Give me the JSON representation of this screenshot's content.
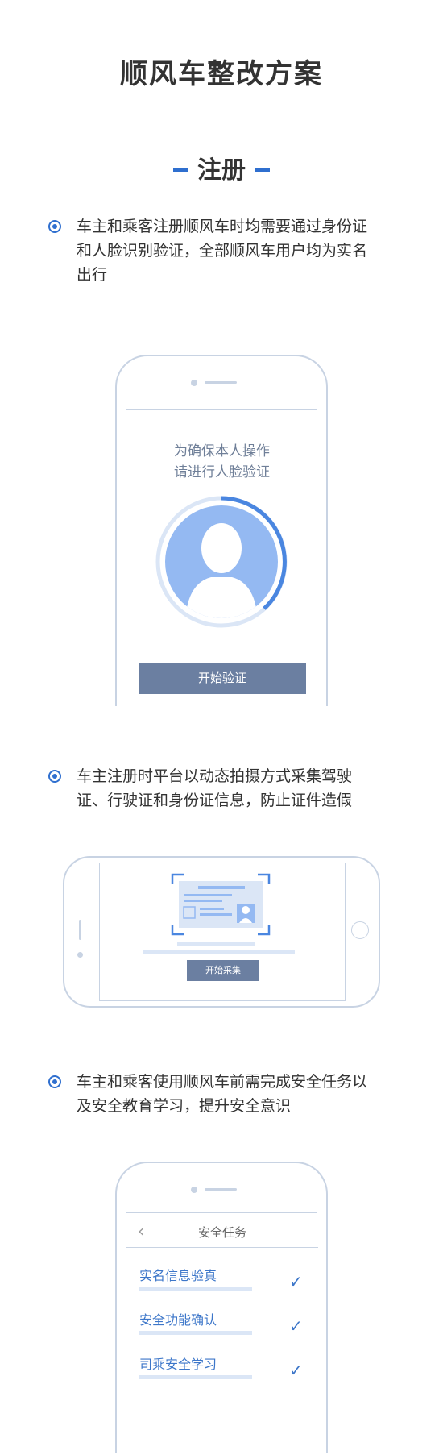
{
  "header": {
    "title": "顺风车整改方案"
  },
  "section": {
    "title": "注册"
  },
  "items": [
    {
      "text_line1": "车主和乘客注册顺风车时均需要通过身份证",
      "text_line2": "和人脸识别验证，全部顺风车用户均为实名",
      "text_line3": "出行"
    },
    {
      "text_line1": "车主注册时平台以动态拍摄方式采集驾驶",
      "text_line2": "证、行驶证和身份证信息，防止证件造假"
    },
    {
      "text_line1": "车主和乘客使用顺风车前需完成安全任务以",
      "text_line2": "及安全教育学习，提升安全意识"
    }
  ],
  "phone1": {
    "prompt_line1": "为确保本人操作",
    "prompt_line2": "请进行人脸验证",
    "button": "开始验证"
  },
  "phone2": {
    "button": "开始采集"
  },
  "phone3": {
    "nav_title": "安全任务",
    "tasks": [
      {
        "label": "实名信息验真",
        "done": true
      },
      {
        "label": "安全功能确认",
        "done": true
      },
      {
        "label": "司乘安全学习",
        "done": true
      }
    ]
  },
  "colors": {
    "accent": "#2f6fcf",
    "button": "#6b7fa1",
    "outline": "#c8d3e3"
  }
}
